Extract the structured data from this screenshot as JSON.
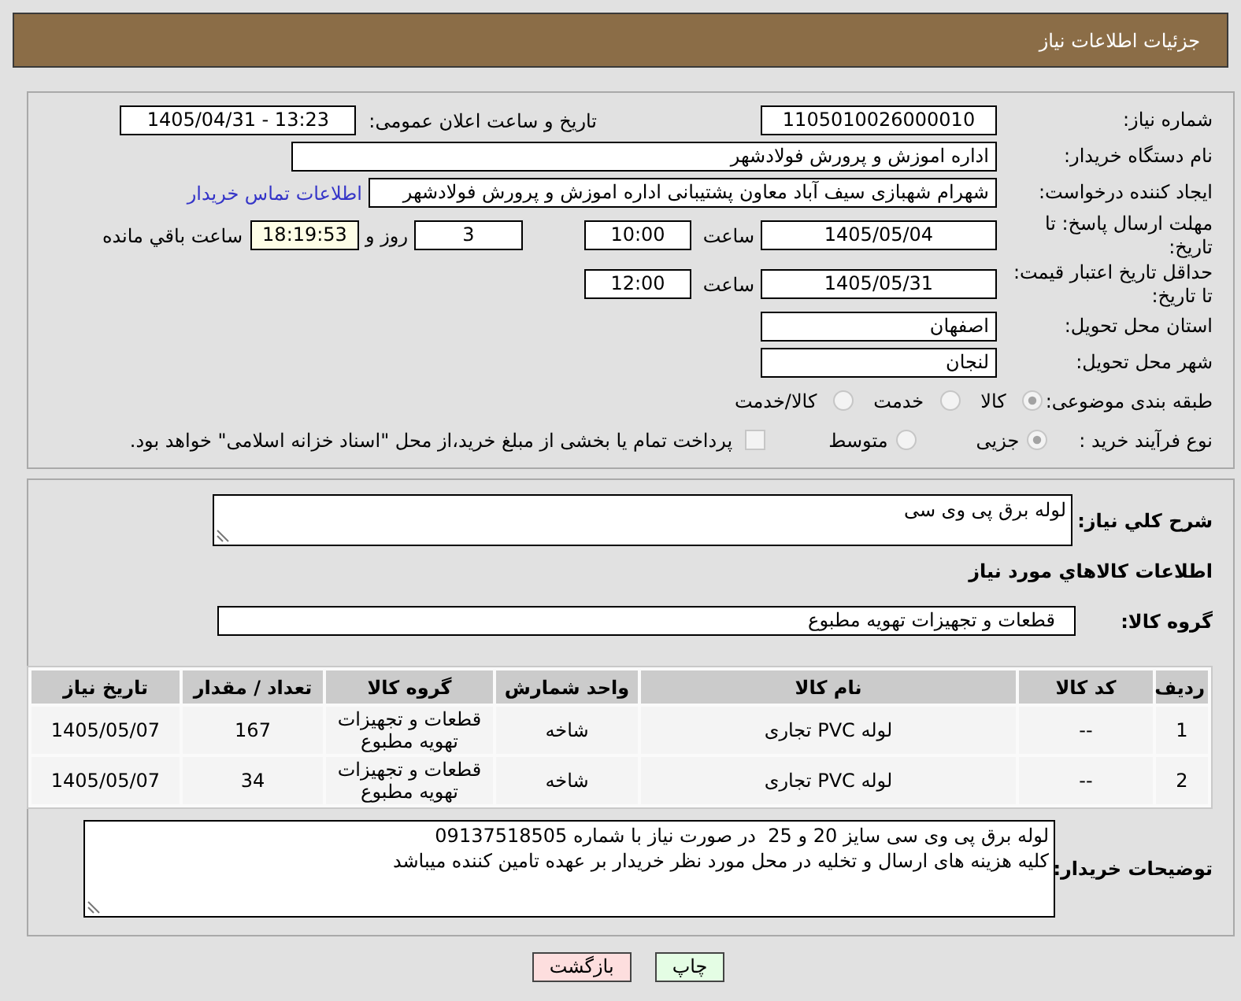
{
  "header": {
    "title": "جزئیات اطلاعات نیاز"
  },
  "details": {
    "need_number": {
      "label": "شماره نیاز:",
      "value": "1105010026000010"
    },
    "announcement": {
      "label": "تاریخ و ساعت اعلان عمومی:",
      "value": "1405/04/31 - 13:23"
    },
    "buyer_name": {
      "label": "نام دستگاه خریدار:",
      "value": "اداره اموزش و پرورش فولادشهر"
    },
    "requester": {
      "label": "ایجاد کننده درخواست:",
      "value": "شهرام شهبازی سیف آباد معاون پشتیبانی  اداره اموزش و پرورش فولادشهر",
      "link": "اطلاعات تماس خریدار"
    },
    "reply_deadline": {
      "label": "مهلت ارسال پاسخ: تا تاریخ:",
      "date": "1405/05/04",
      "time_label": "ساعت",
      "time": "10:00",
      "days": "3",
      "days_label": "روز و",
      "remaining": "18:19:53",
      "remaining_label": "ساعت باقي مانده"
    },
    "price_validity": {
      "label": "حداقل تاریخ اعتبار قیمت: تا تاریخ:",
      "date": "1405/05/31",
      "time_label": "ساعت",
      "time": "12:00"
    },
    "delivery_province": {
      "label": "استان محل تحویل:",
      "value": "اصفهان"
    },
    "delivery_city": {
      "label": "شهر محل تحویل:",
      "value": "لنجان"
    },
    "subject_category": {
      "label": "طبقه بندی موضوعی:",
      "options": [
        {
          "label": "کالا",
          "selected": true
        },
        {
          "label": "خدمت",
          "selected": false
        },
        {
          "label": "کالا/خدمت",
          "selected": false
        }
      ]
    },
    "purchase_process": {
      "label": "نوع فرآیند خرید :",
      "options": [
        {
          "label": "جزیی",
          "selected": true
        },
        {
          "label": "متوسط",
          "selected": false
        }
      ],
      "treasury_payment": {
        "label": "پرداخت تمام یا بخشی از مبلغ خرید،از محل \"اسناد خزانه اسلامی\" خواهد بود.",
        "checked": false
      }
    }
  },
  "items": {
    "description": {
      "label": "شرح کلي نیاز:",
      "value": "لوله برق پی وی سی"
    },
    "section_title": "اطلاعات کالاهاي مورد نیاز",
    "goods_group": {
      "label": "گروه کالا:",
      "value": "قطعات و تجهیزات تهویه مطبوع"
    },
    "table": {
      "columns": [
        "ردیف",
        "کد کالا",
        "نام کالا",
        "واحد شمارش",
        "گروه کالا",
        "تعداد / مقدار",
        "تاریخ نیاز"
      ],
      "rows": [
        [
          "1",
          "--",
          "لوله PVC تجاری",
          "شاخه",
          "قطعات و تجهیزات تهویه مطبوع",
          "167",
          "1405/05/07"
        ],
        [
          "2",
          "--",
          "لوله PVC تجاری",
          "شاخه",
          "قطعات و تجهیزات تهویه مطبوع",
          "34",
          "1405/05/07"
        ]
      ]
    },
    "buyer_notes": {
      "label": "توضیحات خریدار:",
      "value": "لوله برق پی وی سی سایز 20 و 25  در صورت نیاز با شماره 09137518505\nکلیه هزینه های ارسال و تخلیه در محل مورد نظر خریدار بر عهده تامین کننده میباشد"
    }
  },
  "buttons": [
    {
      "kind": "print",
      "label": "چاپ"
    },
    {
      "kind": "back",
      "label": "بازگشت"
    }
  ]
}
